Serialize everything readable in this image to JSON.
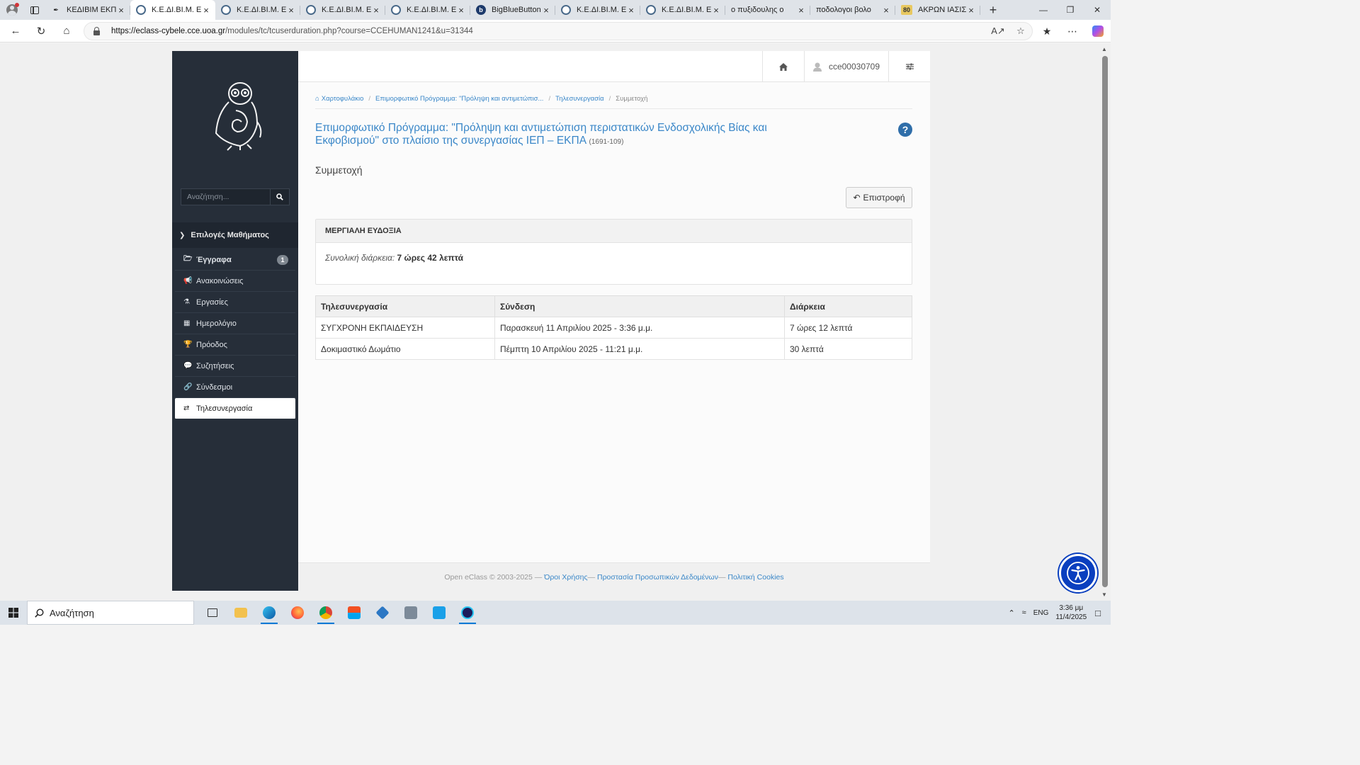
{
  "browser": {
    "tabs": [
      {
        "title": "ΚΕΔΙΒΙΜ ΕΚΠΑ",
        "icon": "feather-icon",
        "active": false
      },
      {
        "title": "Κ.Ε.ΔΙ.ΒΙ.Μ. Ε.Κ.Π",
        "icon": "eclass-icon",
        "active": true
      },
      {
        "title": "Κ.Ε.ΔΙ.ΒΙ.Μ. Ε.Κ.Π",
        "icon": "eclass-icon",
        "active": false
      },
      {
        "title": "Κ.Ε.ΔΙ.ΒΙ.Μ. Ε.Κ.Π",
        "icon": "eclass-icon",
        "active": false
      },
      {
        "title": "Κ.Ε.ΔΙ.ΒΙ.Μ. Ε.Κ.Π",
        "icon": "eclass-icon",
        "active": false
      },
      {
        "title": "BigBlueButton -",
        "icon": "bbb-icon",
        "active": false
      },
      {
        "title": "Κ.Ε.ΔΙ.ΒΙ.Μ. Ε.Κ.Π",
        "icon": "eclass-icon",
        "active": false
      },
      {
        "title": "Κ.Ε.ΔΙ.ΒΙ.Μ. Ε.Κ.Π",
        "icon": "eclass-icon",
        "active": false
      },
      {
        "title": "ο πυξιδουλης ο",
        "icon": "search-icon",
        "active": false
      },
      {
        "title": "ποδολογοι βολο",
        "icon": "search-icon",
        "active": false
      },
      {
        "title": "ΑΚΡΩΝ ΙΑΣΙΣ -",
        "icon": "site-80-icon",
        "favicon_text": "80",
        "active": false
      }
    ],
    "url_host": "https://eclass-cybele.cce.uoa.gr",
    "url_path": "/modules/tc/tcuserduration.php?course=CCEHUMAN1241&u=31344"
  },
  "sidebar": {
    "search_placeholder": "Αναζήτηση...",
    "menu_header": "Επιλογές Μαθήματος",
    "items": [
      {
        "label": "Έγγραφα",
        "icon": "folder-open-icon",
        "badge": "1",
        "bold": true
      },
      {
        "label": "Ανακοινώσεις",
        "icon": "bullhorn-icon"
      },
      {
        "label": "Εργασίες",
        "icon": "flask-icon"
      },
      {
        "label": "Ημερολόγιο",
        "icon": "calendar-icon"
      },
      {
        "label": "Πρόοδος",
        "icon": "trophy-icon"
      },
      {
        "label": "Συζητήσεις",
        "icon": "comments-icon"
      },
      {
        "label": "Σύνδεσμοι",
        "icon": "link-icon"
      },
      {
        "label": "Τηλεσυνεργασία",
        "icon": "exchange-icon",
        "active": true
      }
    ]
  },
  "topbar": {
    "username": "cce00030709"
  },
  "breadcrumb": {
    "home": "Χαρτοφυλάκιο",
    "course": "Επιμορφωτικό Πρόγραμμα: \"Πρόληψη και αντιμετώπισ...",
    "module": "Τηλεσυνεργασία",
    "current": "Συμμετοχή"
  },
  "page": {
    "title": "Επιμορφωτικό Πρόγραμμα: \"Πρόληψη και αντιμετώπιση περιστατικών Ενδοσχολικής Βίας και Εκφοβισμού\" στο πλαίσιο της συνεργασίας ΙΕΠ – ΕΚΠΑ",
    "code": "(1691-109)",
    "subtitle": "Συμμετοχή",
    "back_label": "Επιστροφή"
  },
  "panel": {
    "name": "ΜΕΡΓΙΑΛΗ ΕΥΔΟΞΙΑ",
    "total_label": "Συνολική διάρκεια:",
    "total_value": "7 ώρες 42 λεπτά"
  },
  "table": {
    "headers": [
      "Τηλεσυνεργασία",
      "Σύνδεση",
      "Διάρκεια"
    ],
    "rows": [
      [
        "ΣΥΓΧΡΟΝΗ ΕΚΠΑΙΔΕΥΣΗ",
        "Παρασκευή 11 Απριλίου 2025 - 3:36 μ.μ.",
        "7 ώρες 12 λεπτά"
      ],
      [
        "Δοκιμαστικό Δωμάτιο",
        "Πέμπτη 10 Απριλίου 2025 - 11:21 μ.μ.",
        "30 λεπτά"
      ]
    ]
  },
  "footer": {
    "copyright": "Open eClass © 2003-2025 —",
    "terms": "Όροι Χρήσης",
    "privacy": "Προστασία Προσωπικών Δεδομένων",
    "cookies": "Πολιτική Cookies"
  },
  "taskbar": {
    "search_text": "Αναζήτηση",
    "lang": "ENG",
    "time": "3:36 μμ",
    "date": "11/4/2025"
  },
  "colors": {
    "sidebar_bg": "#262e39",
    "link": "#3a87c8",
    "accessibility": "#0a3fbf"
  }
}
